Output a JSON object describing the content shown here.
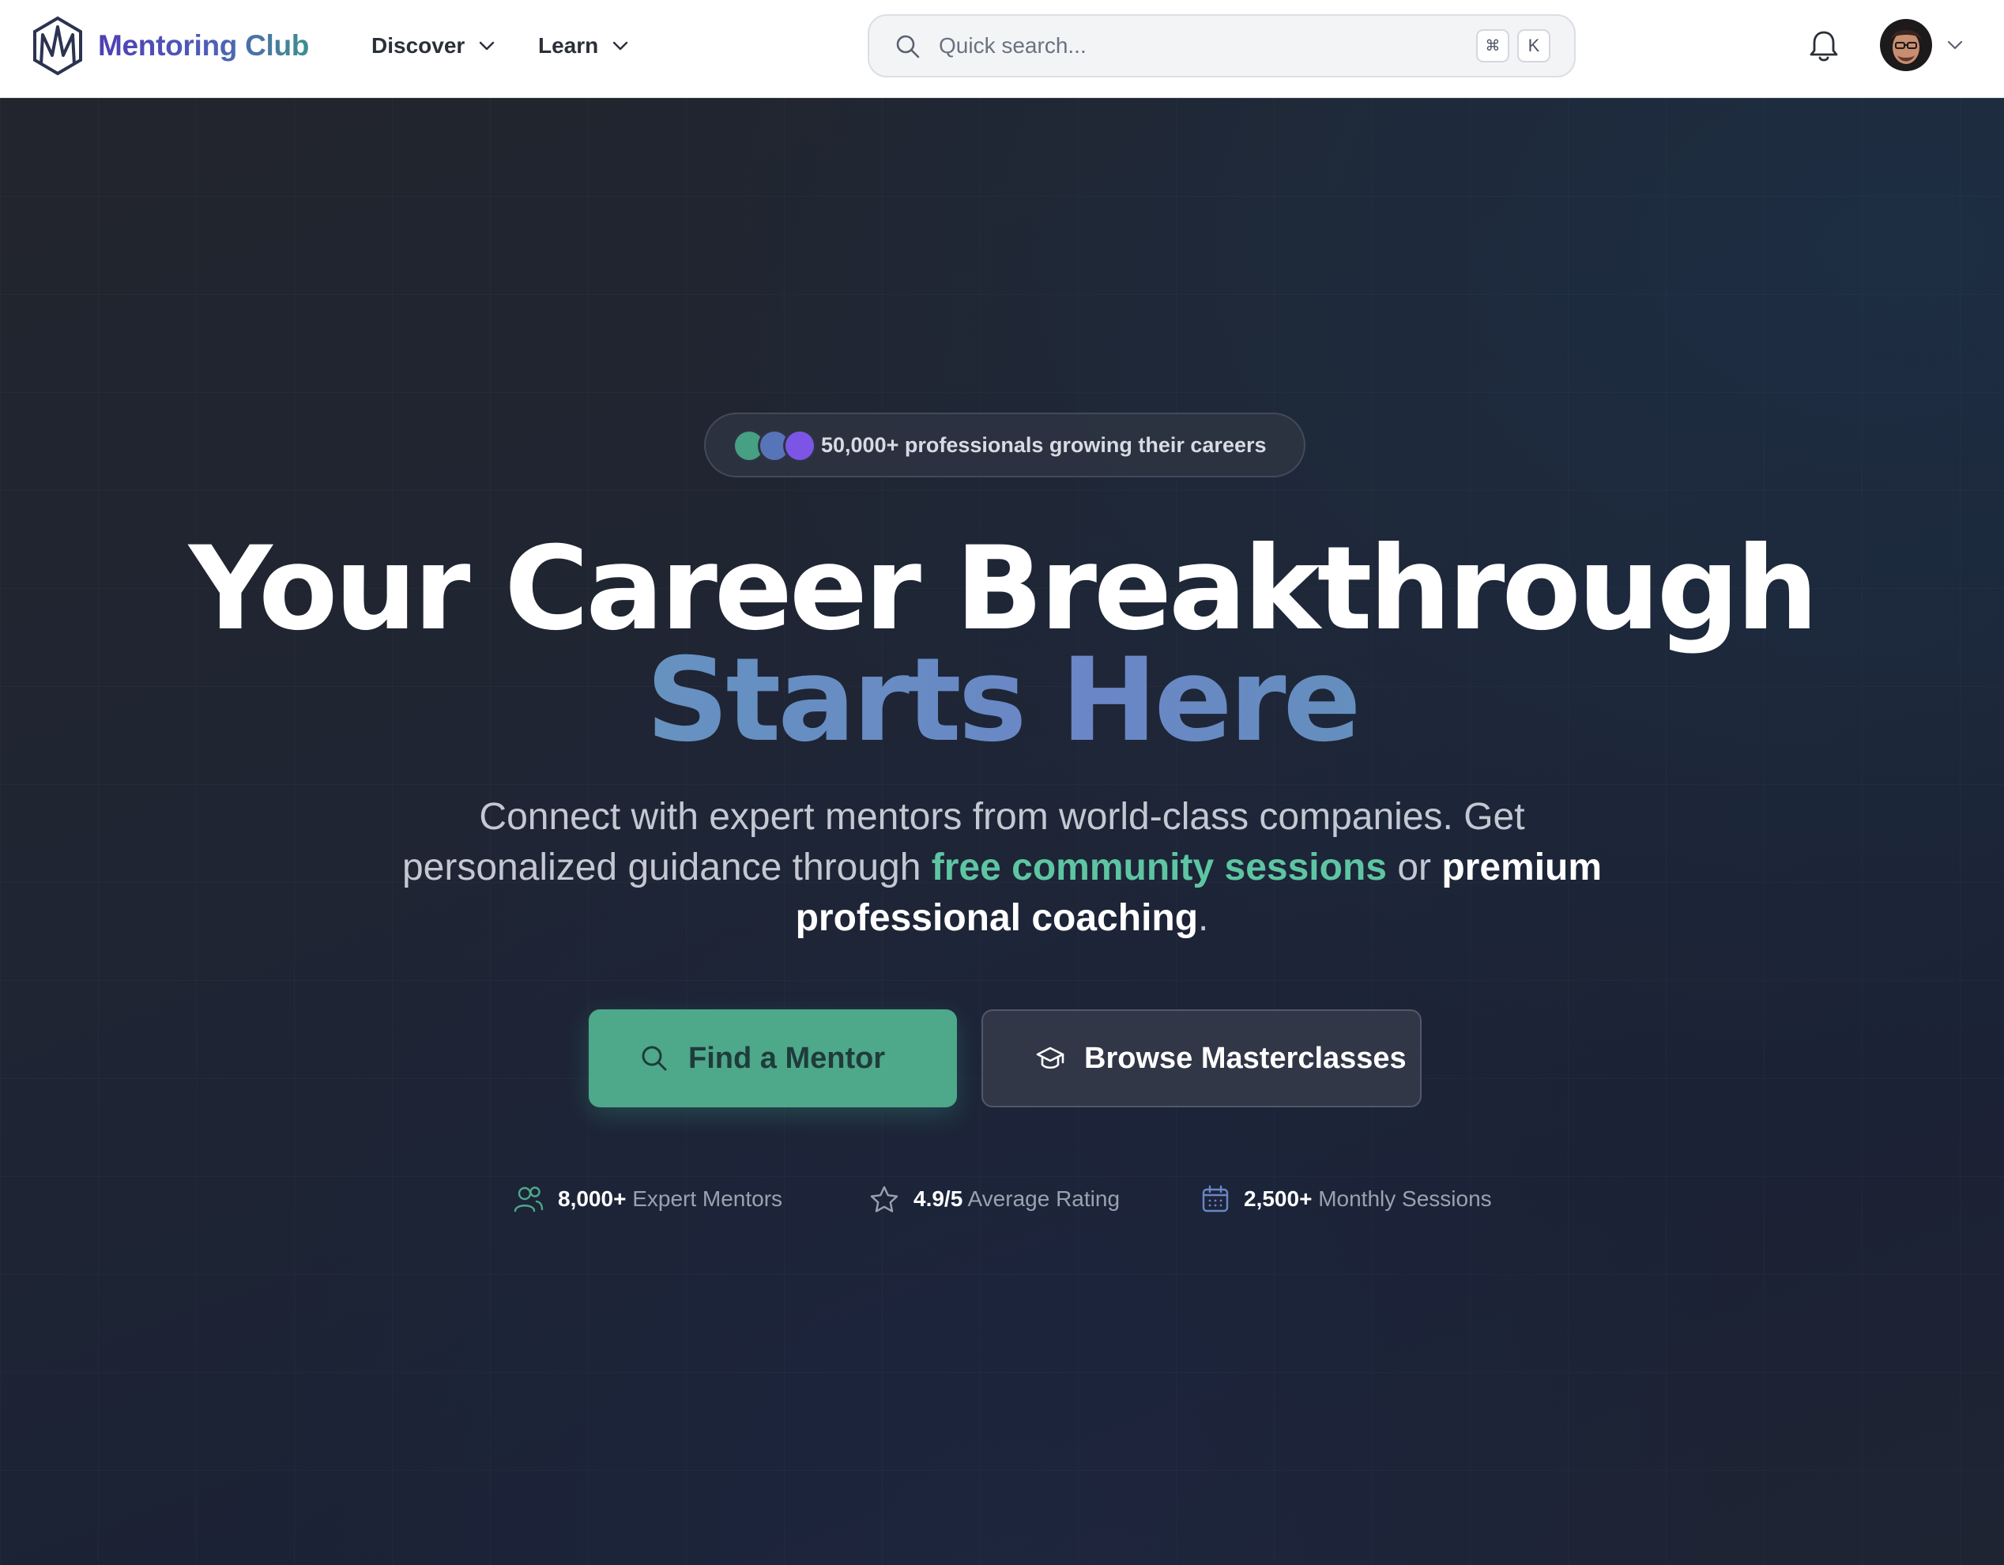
{
  "brand": {
    "name": "Mentoring Club",
    "icon": "mentoring-club-logo"
  },
  "nav": {
    "discover_label": "Discover",
    "learn_label": "Learn"
  },
  "search": {
    "placeholder": "Quick search...",
    "shortcut_modifier": "⌘",
    "shortcut_key": "K"
  },
  "header_icons": {
    "notifications": "bell-icon",
    "account": "avatar",
    "menu": "chevron-down-icon"
  },
  "hero": {
    "badge_text": "50,000+ professionals growing their careers",
    "title_line1": "Your Career Breakthrough",
    "title_line2": "Starts Here",
    "subtitle_part1": "Connect with expert mentors from world-class companies. Get personalized guidance through ",
    "subtitle_highlight1": "free community sessions",
    "subtitle_part2": " or ",
    "subtitle_highlight2": "premium professional coaching",
    "subtitle_part3": ".",
    "cta_primary": "Find a Mentor",
    "cta_secondary": "Browse Masterclasses"
  },
  "stats": [
    {
      "value": "8,000+",
      "label": "Expert Mentors",
      "icon": "users-icon"
    },
    {
      "value": "4.9/5",
      "label": "Average Rating",
      "icon": "star-icon"
    },
    {
      "value": "2,500+",
      "label": "Monthly Sessions",
      "icon": "calendar-icon"
    }
  ],
  "colors": {
    "accent_green": "#4ea88a",
    "highlight_green": "#5ec5a2",
    "brand_purple": "#4f3fb3",
    "hero_bg": "#1f2533"
  }
}
